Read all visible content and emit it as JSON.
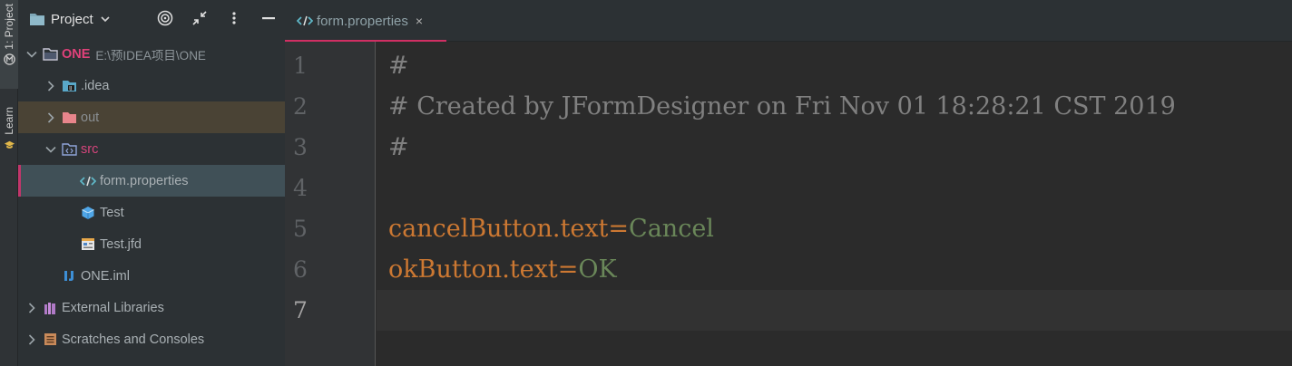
{
  "tool_strip": {
    "project_label": "1: Project",
    "learn_label": "Learn"
  },
  "project_panel": {
    "title": "Project",
    "root": {
      "name": "ONE",
      "path": "E:\\预IDEA项目\\ONE"
    },
    "items": [
      {
        "label": ".idea"
      },
      {
        "label": "out"
      },
      {
        "label": "src"
      },
      {
        "label": "form.properties"
      },
      {
        "label": "Test"
      },
      {
        "label": "Test.jfd"
      },
      {
        "label": "ONE.iml"
      },
      {
        "label": "External Libraries"
      },
      {
        "label": "Scratches and Consoles"
      }
    ]
  },
  "editor": {
    "tab_label": "form.properties",
    "tab_close": "×",
    "line_numbers": [
      "1",
      "2",
      "3",
      "4",
      "5",
      "6",
      "7"
    ],
    "current_line": 7,
    "lines": [
      {
        "comment": "#"
      },
      {
        "comment": "# Created by JFormDesigner on Fri Nov 01 18:28:21 CST 2019"
      },
      {
        "comment": "#"
      },
      {
        "comment": ""
      },
      {
        "key": "cancelButton.text",
        "eq": "=",
        "value": "Cancel"
      },
      {
        "key": "okButton.text",
        "eq": "=",
        "value": "OK"
      },
      {
        "comment": ""
      }
    ]
  },
  "colors": {
    "accent": "#d02f63",
    "comment": "#808080",
    "key": "#cc7832",
    "value": "#6a8759"
  }
}
